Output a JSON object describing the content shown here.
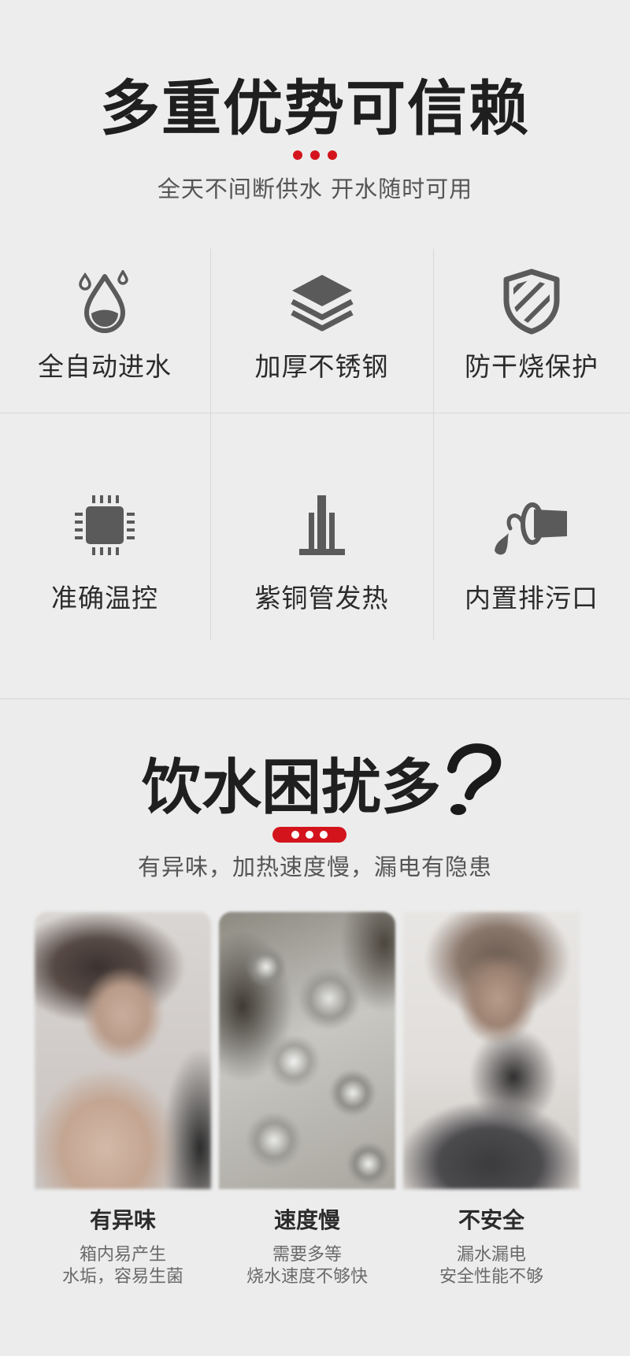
{
  "section1": {
    "title": "多重优势可信赖",
    "subtitle": "全天不间断供水 开水随时可用",
    "features": [
      {
        "label": "全自动进水",
        "icon": "water-drop-icon"
      },
      {
        "label": "加厚不锈钢",
        "icon": "layers-icon"
      },
      {
        "label": "防干烧保护",
        "icon": "shield-icon"
      },
      {
        "label": "准确温控",
        "icon": "chip-icon"
      },
      {
        "label": "紫铜管发热",
        "icon": "heating-pipe-icon"
      },
      {
        "label": "内置排污口",
        "icon": "drain-outlet-icon"
      }
    ]
  },
  "section2": {
    "title": "饮水困扰多",
    "subtitle": "有异味，加热速度慢，漏电有隐患",
    "cards": [
      {
        "title": "有异味",
        "line1": "箱内易产生",
        "line2": "水垢，容易生菌"
      },
      {
        "title": "速度慢",
        "line1": "需要多等",
        "line2": "烧水速度不够快"
      },
      {
        "title": "不安全",
        "line1": "漏水漏电",
        "line2": "安全性能不够"
      }
    ]
  },
  "colors": {
    "accent": "#d4141c",
    "icon": "#5a5a5a",
    "background": "#ededed"
  }
}
